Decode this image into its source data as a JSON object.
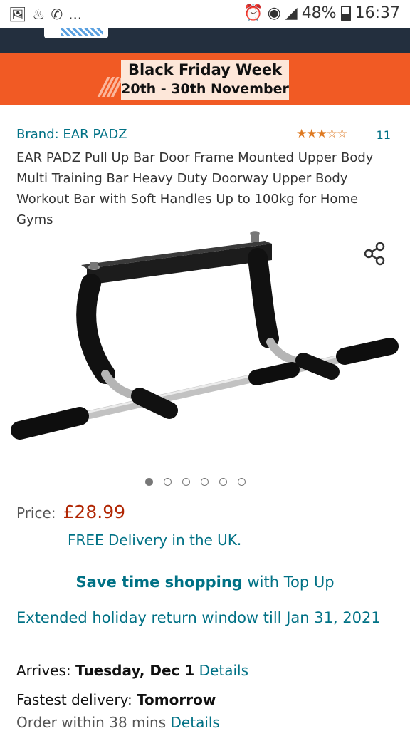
{
  "status_bar": {
    "left_icons": [
      "image-icon",
      "flag-icon",
      "whatsapp-icon"
    ],
    "more": "...",
    "battery": "48%",
    "time": "16:37"
  },
  "promo": {
    "line1": "Black Friday Week",
    "line2": "20th - 30th November"
  },
  "product": {
    "brand": "Brand: EAR PADZ",
    "rating": 3.5,
    "stars_text": "★★★☆☆",
    "rating_count": "11",
    "title": "EAR PADZ Pull Up Bar Door Frame Mounted Upper Body Multi Training Bar Heavy Duty Doorway Upper Body Workout Bar with Soft Handles Up to 100kg for Home Gyms"
  },
  "gallery": {
    "image_count": 6,
    "active_index": 0
  },
  "price": {
    "label": "Price:",
    "value": "£28.99",
    "delivery": "FREE Delivery in the UK."
  },
  "promo_links": {
    "save_bold": "Save time shopping",
    "save_rest": " with Top Up",
    "extended_return": "Extended holiday return window till Jan 31, 2021"
  },
  "delivery": {
    "arrives_label": "Arrives: ",
    "arrives_date": "Tuesday, Dec 1",
    "details": "Details",
    "fastest_label": "Fastest delivery: ",
    "fastest_value": "Tomorrow",
    "order_within": "Order within 38 mins"
  },
  "colors": {
    "link": "#007185",
    "price": "#b12704",
    "promo": "#f15a24",
    "header": "#232f3e"
  }
}
